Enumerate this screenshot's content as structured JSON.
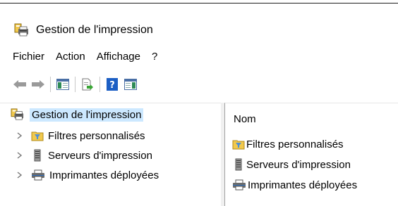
{
  "window": {
    "title": "Gestion de l'impression",
    "icon": "print-management-icon"
  },
  "menubar": {
    "items": [
      "Fichier",
      "Action",
      "Affichage",
      "?"
    ]
  },
  "toolbar": {
    "buttons": [
      "back-arrow-icon",
      "forward-arrow-icon",
      "show-hide-console-tree-icon",
      "export-list-icon",
      "help-icon",
      "show-hide-action-pane-icon"
    ]
  },
  "tree": {
    "root": {
      "label": "Gestion de l'impression",
      "selected": true
    },
    "children": [
      {
        "label": "Filtres personnalisés",
        "icon": "filter-folder-icon"
      },
      {
        "label": "Serveurs d'impression",
        "icon": "server-icon"
      },
      {
        "label": "Imprimantes déployées",
        "icon": "printer-icon"
      }
    ]
  },
  "list": {
    "column_header": "Nom",
    "items": [
      {
        "label": "Filtres personnalisés",
        "icon": "filter-folder-icon"
      },
      {
        "label": "Serveurs d'impression",
        "icon": "server-icon"
      },
      {
        "label": "Imprimantes déployées",
        "icon": "printer-icon"
      }
    ]
  },
  "colors": {
    "selection_bg": "#cce8ff",
    "arrow": "#9a9a9a",
    "help_blue": "#1c5fc4",
    "folder_yellow": "#f2c94c"
  }
}
